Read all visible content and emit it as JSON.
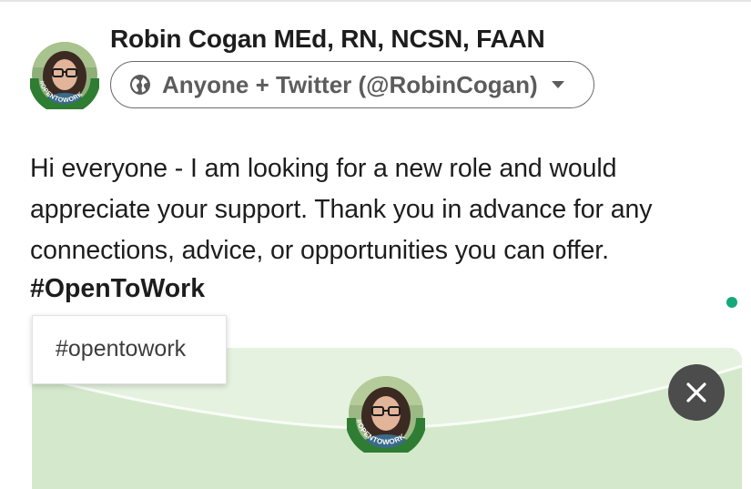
{
  "author": {
    "name": "Robin Cogan MEd, RN, NCSN, FAAN",
    "avatar_icon": "profile-photo-opentowork-frame",
    "frame_text": "#OPENTOWORK"
  },
  "visibility": {
    "label": "Anyone + Twitter (@RobinCogan)",
    "icon": "globe-icon",
    "caret_icon": "caret-down-icon"
  },
  "post": {
    "lines": [
      "Hi everyone - I am looking for a new role and would",
      "appreciate your support. Thank you in advance for any",
      "connections, advice, or opportunities you can offer."
    ],
    "hashtag": "#OpenToWork"
  },
  "suggestions": {
    "items": [
      "#opentowork"
    ]
  },
  "preview": {
    "close_icon": "close-icon"
  },
  "colors": {
    "open_to_work_green": "#2e7d32",
    "preview_bg": "#cfe6c6",
    "status_dot": "#15a87a",
    "close_button": "#4c4c4c"
  }
}
